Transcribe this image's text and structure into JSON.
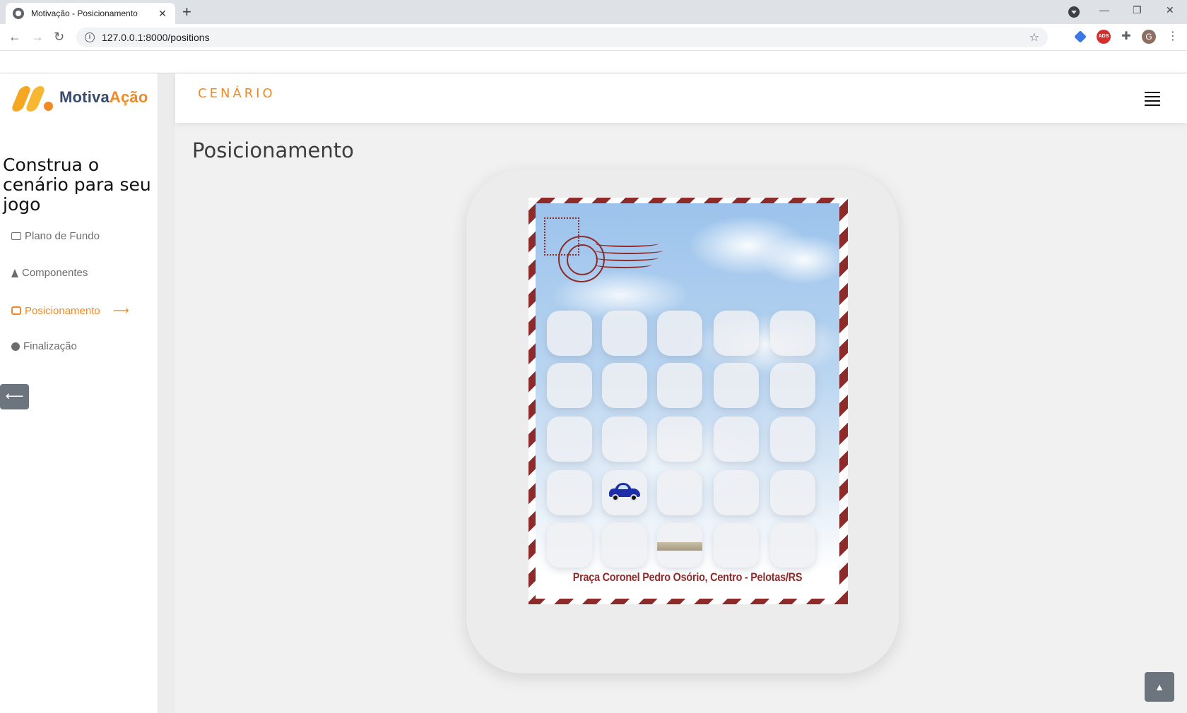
{
  "browser": {
    "tab_title": "Motivação - Posicionamento",
    "tab_close": "✕",
    "new_tab": "+",
    "url": "127.0.0.1:8000/positions",
    "avatar_letter": "G",
    "ext_ads_label": "ADS",
    "window_controls": {
      "minimize": "—",
      "restore": "❐",
      "close": "✕"
    },
    "nav": {
      "back": "←",
      "forward": "→",
      "reload": "↻"
    }
  },
  "app": {
    "logo": {
      "part1": "Motiva",
      "part2": "Ação"
    },
    "brand": "CENÁRIO",
    "sidebar": {
      "heading": "Construa o cenário para seu jogo",
      "items": [
        {
          "label": "Plano de Fundo",
          "icon": "image-icon"
        },
        {
          "label": "Componentes",
          "icon": "tree-icon"
        },
        {
          "label": "Posicionamento",
          "icon": "cubes-icon",
          "active": true,
          "arrow": "⟶"
        },
        {
          "label": "Finalização",
          "icon": "check-circle-icon"
        }
      ],
      "back_button": "⟵"
    },
    "page_title": "Posicionamento",
    "card": {
      "caption": "Praça Coronel Pedro Osório, Centro - Pelotas/RS",
      "grid_rows": 5,
      "grid_cols": 5,
      "items": [
        {
          "row": 4,
          "col": 2,
          "type": "car-icon"
        },
        {
          "row": 5,
          "col": 3,
          "type": "plank-icon"
        }
      ]
    },
    "scroll_top": "▲"
  }
}
